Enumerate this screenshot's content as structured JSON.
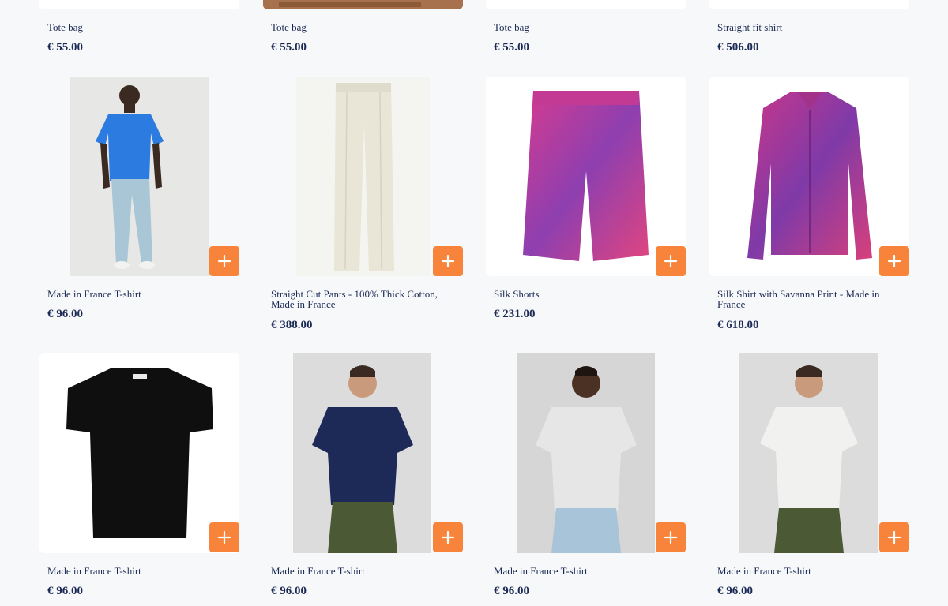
{
  "products": [
    {
      "name": "Tote bag",
      "price": "€ 55.00",
      "image": "white-bag-icon"
    },
    {
      "name": "Tote bag",
      "price": "€ 55.00",
      "image": "brown-bag-icon"
    },
    {
      "name": "Tote bag",
      "price": "€ 55.00",
      "image": "white-bag-icon"
    },
    {
      "name": "Straight fit shirt",
      "price": "€ 506.00",
      "image": "shirt-icon"
    },
    {
      "name": "Made in France T-shirt",
      "price": "€ 96.00",
      "image": "model-blue-tshirt-icon"
    },
    {
      "name": "Straight Cut Pants - 100% Thick Cotton, Made in France",
      "price": "€ 388.00",
      "image": "cream-pants-icon"
    },
    {
      "name": "Silk Shorts",
      "price": "€ 231.00",
      "image": "pink-silk-shorts-icon"
    },
    {
      "name": "Silk Shirt with Savanna Print - Made in France",
      "price": "€ 618.00",
      "image": "pink-silk-shirt-icon"
    },
    {
      "name": "Made in France T-shirt",
      "price": "€ 96.00",
      "image": "black-tshirt-icon"
    },
    {
      "name": "Made in France T-shirt",
      "price": "€ 96.00",
      "image": "model-navy-tshirt-icon"
    },
    {
      "name": "Made in France T-shirt",
      "price": "€ 96.00",
      "image": "model-grey-tshirt-icon"
    },
    {
      "name": "Made in France T-shirt",
      "price": "€ 96.00",
      "image": "model-white-tshirt-icon"
    }
  ],
  "add_icon": "plus-icon",
  "colors": {
    "accent": "#f7843a",
    "text": "#1b2a55",
    "background": "#f7f8fa"
  }
}
